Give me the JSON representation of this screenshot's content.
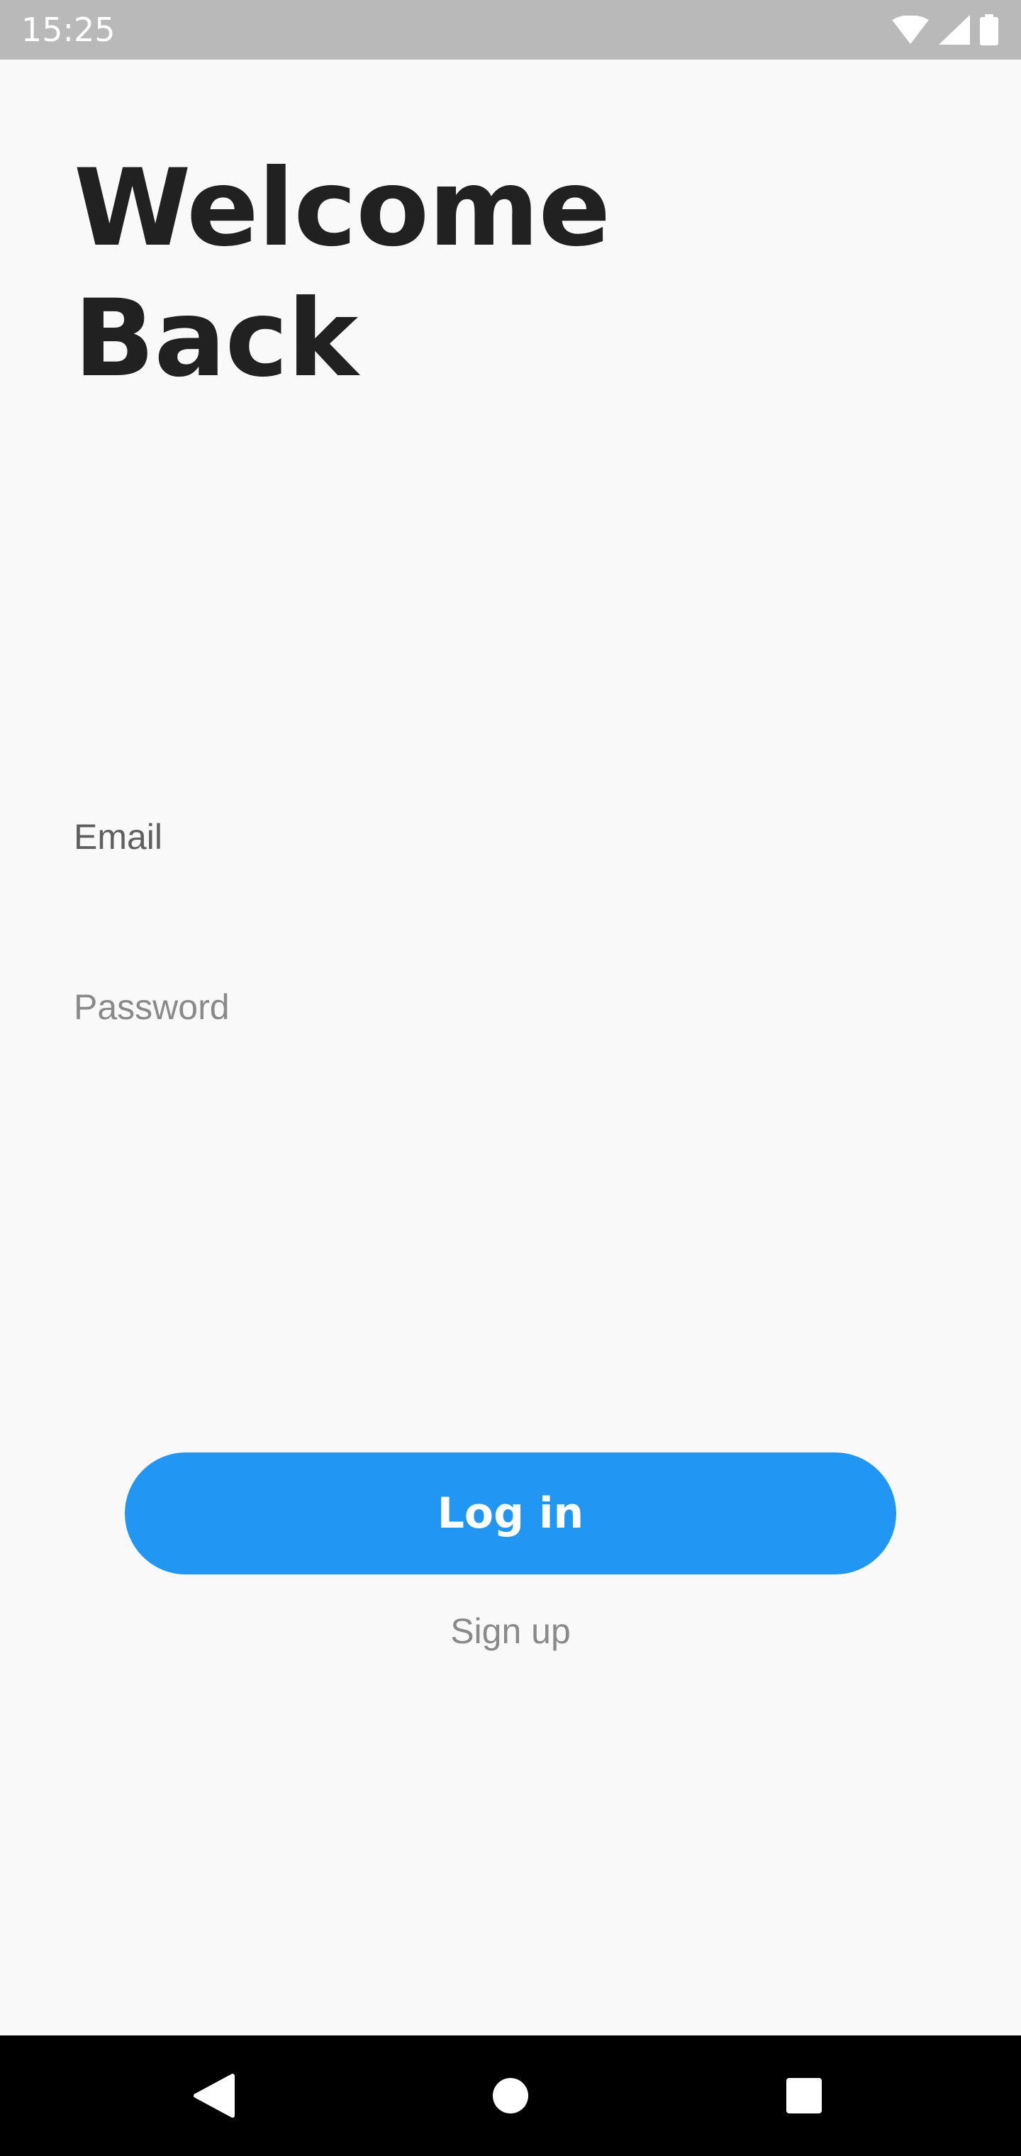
{
  "status_bar": {
    "time": "15:25",
    "icons": [
      "wifi-icon",
      "signal-icon",
      "battery-icon"
    ]
  },
  "screen": {
    "title_line1": "Welcome",
    "title_line2": "Back"
  },
  "form": {
    "email_label": "Email",
    "password_label": "Password"
  },
  "actions": {
    "login_label": "Log in",
    "signup_label": "Sign up"
  },
  "nav_bar": {
    "buttons": [
      "back-icon",
      "home-icon",
      "recents-icon"
    ]
  },
  "colors": {
    "accent": "#2196f3",
    "background": "#f9f9f9",
    "status_bar": "#b9b9b9",
    "title_text": "#212121"
  }
}
